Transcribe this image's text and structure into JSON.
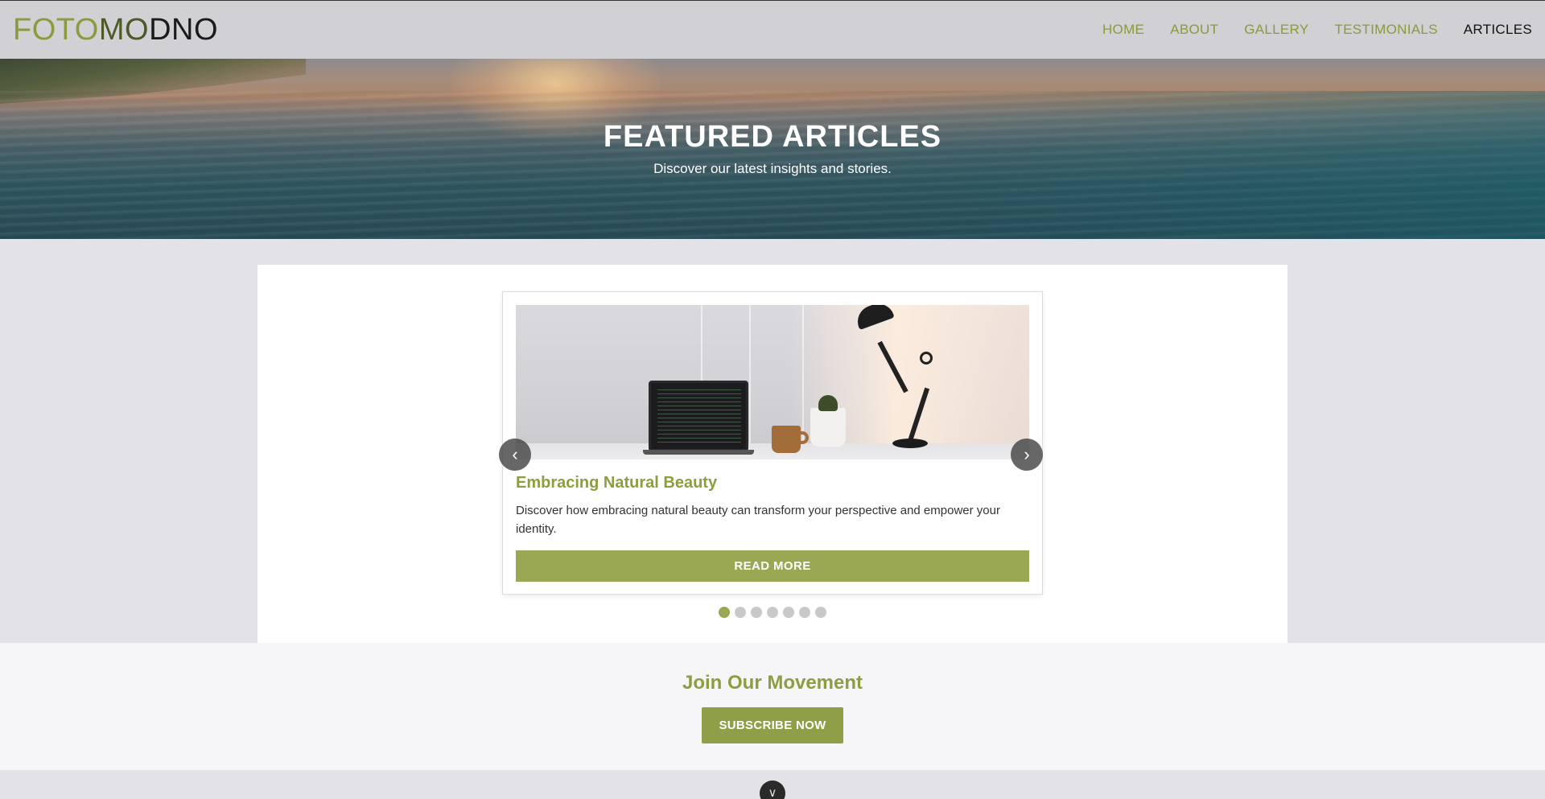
{
  "logo": {
    "part1": "FOTO",
    "part2": "MO",
    "part3": "DNO"
  },
  "nav": {
    "items": [
      {
        "label": "HOME"
      },
      {
        "label": "ABOUT"
      },
      {
        "label": "GALLERY"
      },
      {
        "label": "TESTIMONIALS"
      },
      {
        "label": "ARTICLES",
        "active": true
      }
    ]
  },
  "hero": {
    "title": "FEATURED ARTICLES",
    "subtitle": "Discover our latest insights and stories."
  },
  "carousel": {
    "card": {
      "title": "Embracing Natural Beauty",
      "description": "Discover how embracing natural beauty can transform your perspective and empower your identity.",
      "button_label": "READ MORE"
    },
    "prev_icon": "‹",
    "next_icon": "›",
    "dots_count": 7,
    "active_dot": 1
  },
  "join": {
    "title": "Join Our Movement",
    "button_label": "SUBSCRIBE NOW"
  },
  "scroll_icon": "∨",
  "colors": {
    "accent": "#8c9e3f",
    "button": "#9aa853",
    "nav_bg": "#d1d0d5",
    "page_bg": "#e2e2e8"
  }
}
